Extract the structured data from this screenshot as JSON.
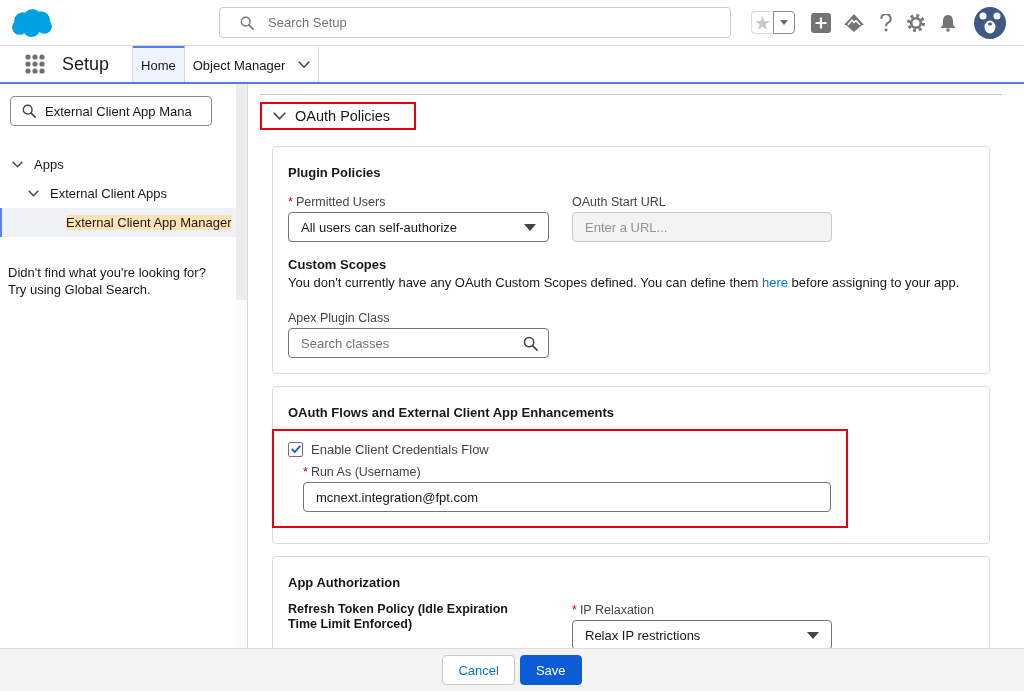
{
  "header": {
    "search": {
      "placeholder": "Search Setup"
    }
  },
  "nav": {
    "app_title": "Setup",
    "tabs": [
      {
        "label": "Home",
        "selected": true,
        "has_menu": false
      },
      {
        "label": "Object Manager",
        "selected": false,
        "has_menu": true
      }
    ]
  },
  "sidebar": {
    "quick_find": {
      "value": "External Client App Mana"
    },
    "tree": [
      {
        "label": "Apps",
        "expanded": true,
        "selected": false,
        "search_match": false,
        "children": [
          {
            "label": "External Client Apps",
            "expanded": true,
            "selected": false,
            "search_match": false,
            "children": [
              {
                "label": "External Client App Manager",
                "selected": true,
                "search_match": true
              }
            ]
          }
        ]
      }
    ],
    "help_text": "Didn't find what you're looking for? Try using Global Search."
  },
  "section": {
    "title": "OAuth Policies",
    "expanded": true,
    "highlighted": true,
    "plugin_policies": {
      "title": "Plugin Policies",
      "permitted_users": {
        "required_mark": "*",
        "label": "Permitted Users",
        "value": "All users can self-authorize"
      },
      "oauth_start_url": {
        "label": "OAuth Start URL",
        "placeholder": "Enter a URL...",
        "disabled": true
      },
      "custom_scopes": {
        "title": "Custom Scopes",
        "text_before": "You don't currently have any OAuth Custom Scopes defined. You can define them ",
        "link": "here",
        "text_after": " before assigning to your app."
      },
      "apex_plugin_class": {
        "label": "Apex Plugin Class",
        "placeholder": "Search classes"
      }
    },
    "oauth_flows": {
      "title": "OAuth Flows and External Client App Enhancements",
      "credentials_group": {
        "highlighted": true,
        "checkbox": {
          "label": "Enable Client Credentials Flow",
          "checked": true
        },
        "run_as": {
          "required_mark": "*",
          "label": "Run As (Username)",
          "value": "mcnext.integration@fpt.com"
        }
      }
    },
    "app_authorization": {
      "title": "App Authorization",
      "refresh_token_policy": {
        "label": "Refresh Token Policy (Idle Expiration Time Limit Enforced)"
      },
      "ip_relaxation": {
        "required_mark": "*",
        "label": "IP Relaxation",
        "value": "Relax IP restrictions"
      }
    }
  },
  "footer": {
    "buttons": [
      {
        "label": "Cancel",
        "kind": "neutral"
      },
      {
        "label": "Save",
        "kind": "brand"
      }
    ]
  }
}
